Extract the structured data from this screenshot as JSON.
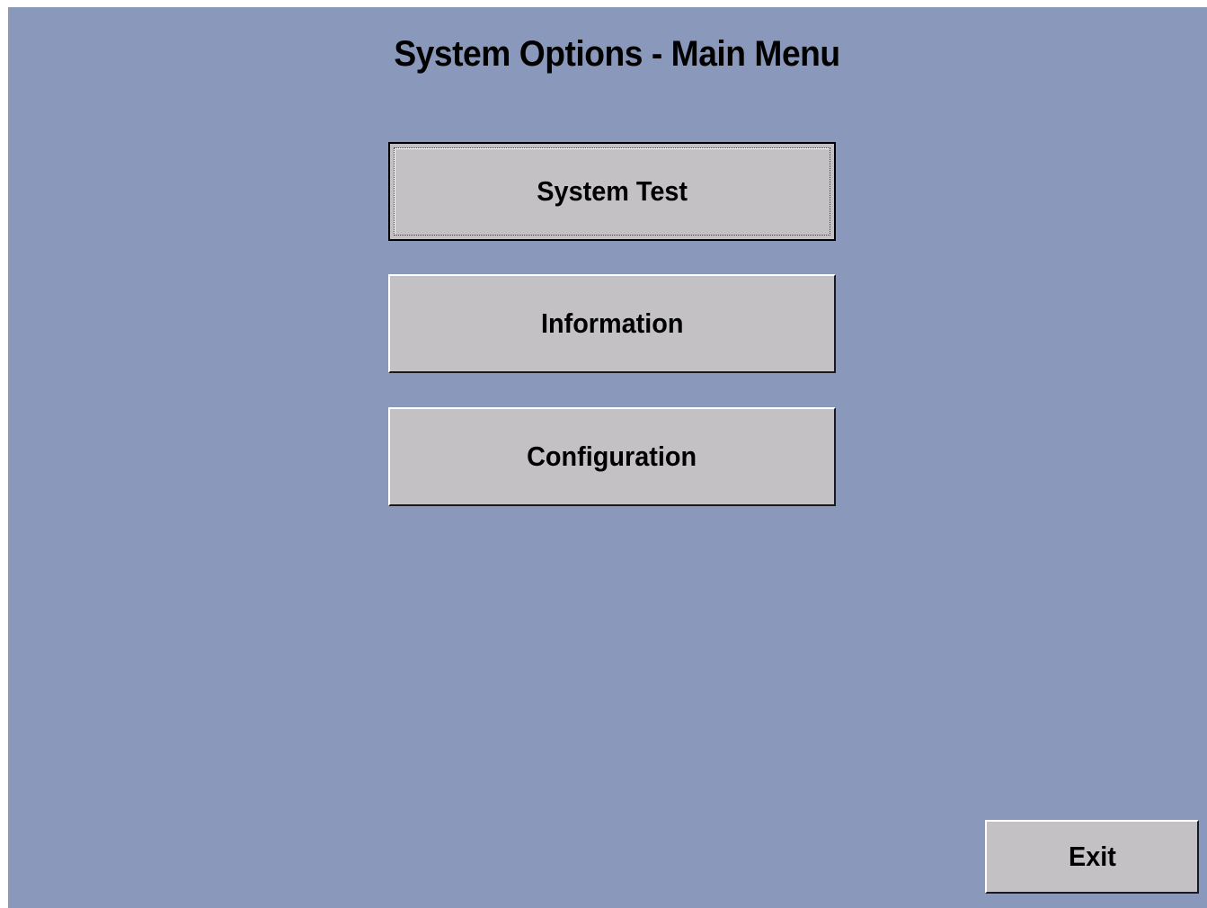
{
  "screen": {
    "title": "System Options - Main Menu",
    "background_color": "#8a99bb",
    "button_color": "#c3c1c4"
  },
  "menu": {
    "items": [
      {
        "label": "System Test",
        "focused": true
      },
      {
        "label": "Information",
        "focused": false
      },
      {
        "label": "Configuration",
        "focused": false
      }
    ]
  },
  "footer": {
    "exit_label": "Exit"
  }
}
